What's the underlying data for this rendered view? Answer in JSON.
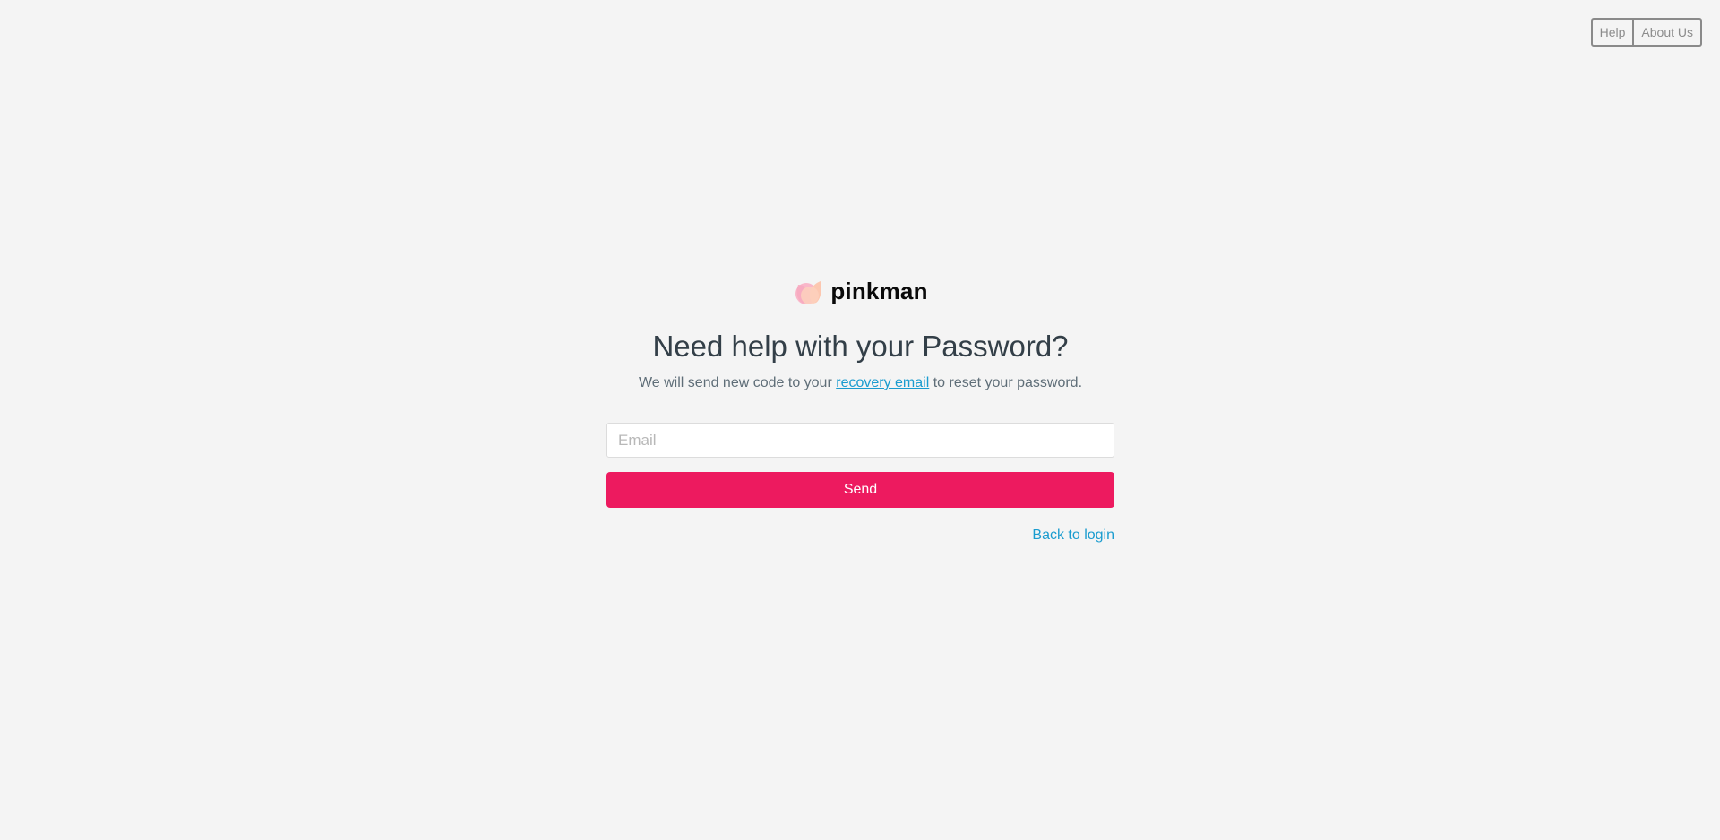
{
  "topnav": {
    "help_label": "Help",
    "about_label": "About Us"
  },
  "brand": {
    "name": "pinkman",
    "logo_icon": "pinkman-logo-icon",
    "logo_colors": [
      "#f9b7c9",
      "#fcc7b0"
    ]
  },
  "page": {
    "title": "Need help with your Password?",
    "subtitle_before": "We will send new code to your ",
    "subtitle_link": "recovery email",
    "subtitle_after": " to reset your password."
  },
  "form": {
    "email_placeholder": "Email",
    "email_value": "",
    "send_label": "Send",
    "back_label": "Back to login"
  },
  "colors": {
    "accent": "#ed1a5f",
    "link": "#1a9ccf",
    "background": "#f4f4f4"
  }
}
